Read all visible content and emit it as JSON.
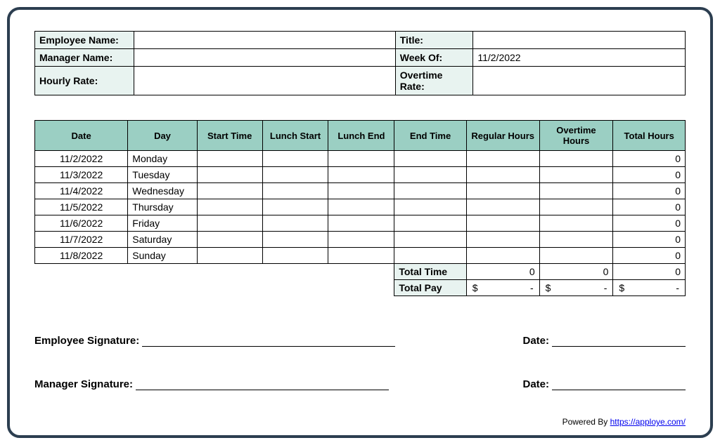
{
  "info": {
    "employeeNameLabel": "Employee Name:",
    "employeeName": "",
    "titleLabel": "Title:",
    "title": "",
    "managerNameLabel": "Manager Name:",
    "managerName": "",
    "weekOfLabel": "Week Of:",
    "weekOf": "11/2/2022",
    "hourlyRateLabel": "Hourly Rate:",
    "hourlyRate": "",
    "overtimeRateLabel": "Overtime Rate:",
    "overtimeRate": ""
  },
  "headers": {
    "date": "Date",
    "day": "Day",
    "startTime": "Start Time",
    "lunchStart": "Lunch Start",
    "lunchEnd": "Lunch End",
    "endTime": "End Time",
    "regularHours": "Regular Hours",
    "overtimeHours": "Overtime Hours",
    "totalHours": "Total Hours"
  },
  "rows": [
    {
      "date": "11/2/2022",
      "day": "Monday",
      "startTime": "",
      "lunchStart": "",
      "lunchEnd": "",
      "endTime": "",
      "regularHours": "",
      "overtimeHours": "",
      "totalHours": "0"
    },
    {
      "date": "11/3/2022",
      "day": "Tuesday",
      "startTime": "",
      "lunchStart": "",
      "lunchEnd": "",
      "endTime": "",
      "regularHours": "",
      "overtimeHours": "",
      "totalHours": "0"
    },
    {
      "date": "11/4/2022",
      "day": "Wednesday",
      "startTime": "",
      "lunchStart": "",
      "lunchEnd": "",
      "endTime": "",
      "regularHours": "",
      "overtimeHours": "",
      "totalHours": "0"
    },
    {
      "date": "11/5/2022",
      "day": "Thursday",
      "startTime": "",
      "lunchStart": "",
      "lunchEnd": "",
      "endTime": "",
      "regularHours": "",
      "overtimeHours": "",
      "totalHours": "0"
    },
    {
      "date": "11/6/2022",
      "day": "Friday",
      "startTime": "",
      "lunchStart": "",
      "lunchEnd": "",
      "endTime": "",
      "regularHours": "",
      "overtimeHours": "",
      "totalHours": "0"
    },
    {
      "date": "11/7/2022",
      "day": "Saturday",
      "startTime": "",
      "lunchStart": "",
      "lunchEnd": "",
      "endTime": "",
      "regularHours": "",
      "overtimeHours": "",
      "totalHours": "0"
    },
    {
      "date": "11/8/2022",
      "day": "Sunday",
      "startTime": "",
      "lunchStart": "",
      "lunchEnd": "",
      "endTime": "",
      "regularHours": "",
      "overtimeHours": "",
      "totalHours": "0"
    }
  ],
  "totals": {
    "totalTimeLabel": "Total Time",
    "regularTotal": "0",
    "overtimeTotal": "0",
    "hoursTotal": "0",
    "totalPayLabel": "Total Pay",
    "currency": "$",
    "dash": "-"
  },
  "signatures": {
    "employeeSigLabel": "Employee Signature:",
    "managerSigLabel": "Manager Signature:",
    "dateLabel": "Date:"
  },
  "footer": {
    "poweredBy": "Powered By ",
    "link": "https://apploye.com/"
  }
}
